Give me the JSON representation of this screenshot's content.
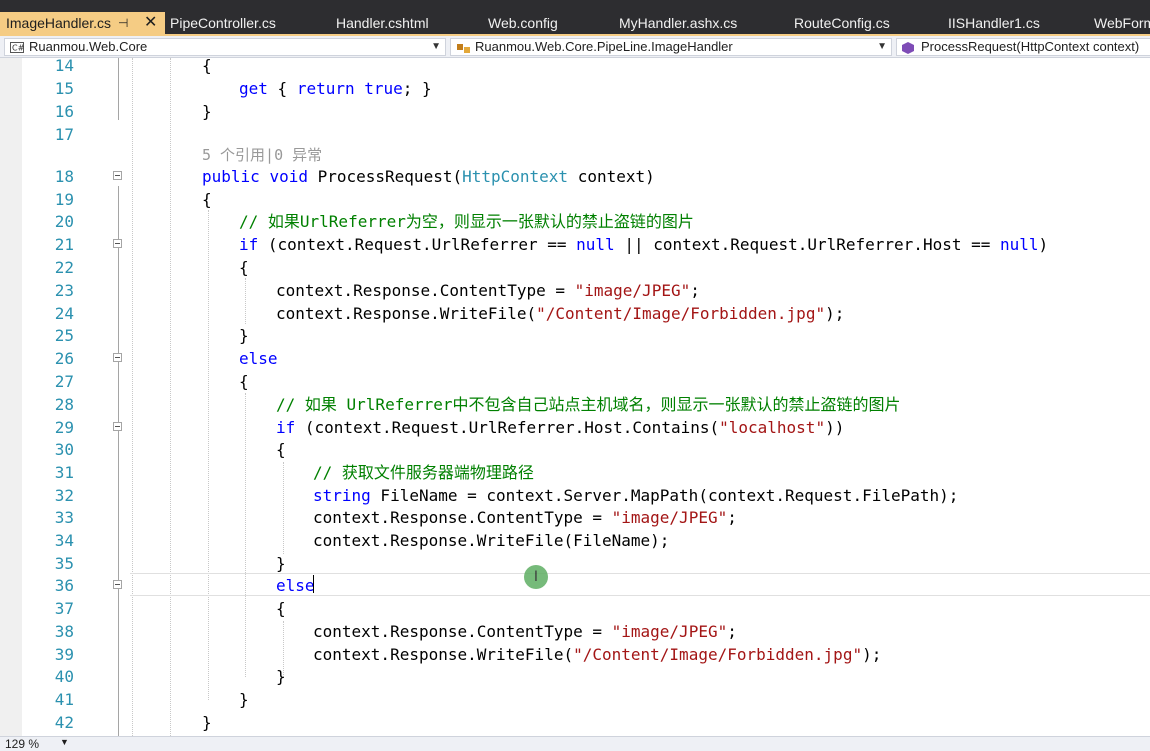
{
  "tabs": [
    {
      "label": "ImageHandler.cs",
      "active": true
    },
    {
      "label": "PipeController.cs"
    },
    {
      "label": "Handler.cshtml"
    },
    {
      "label": "Web.config"
    },
    {
      "label": "MyHandler.ashx.cs"
    },
    {
      "label": "RouteConfig.cs"
    },
    {
      "label": "IISHandler1.cs"
    },
    {
      "label": "WebForm"
    }
  ],
  "tab_pin": "⊣",
  "tab_close": "✕",
  "nav": {
    "project": "Ruanmou.Web.Core",
    "type": "Ruanmou.Web.Core.PipeLine.ImageHandler",
    "member": "ProcessRequest(HttpContext context)"
  },
  "code": {
    "ref_hint": "5 个引用|0 异常",
    "lines": {
      "l14": "{",
      "l15_kw1": "get",
      "l15_p1": " { ",
      "l15_kw2": "return",
      "l15_kw3": "true",
      "l15_p2": "; }",
      "l16": "}",
      "l18_kw1": "public",
      "l18_kw2": "void",
      "l18_p1": " ProcessRequest(",
      "l18_ty": "HttpContext",
      "l18_p2": " context)",
      "l19": "{",
      "l20": "// 如果UrlReferrer为空，则显示一张默认的禁止盗链的图片",
      "l21_kw": "if",
      "l21_p1": " (context.Request.UrlReferrer == ",
      "l21_null1": "null",
      "l21_p2": " || context.Request.UrlReferrer.Host == ",
      "l21_null2": "null",
      "l21_p3": ")",
      "l22": "{",
      "l23_p": "context.Response.ContentType = ",
      "l23_s": "\"image/JPEG\"",
      "l23_e": ";",
      "l24_p": "context.Response.WriteFile(",
      "l24_s": "\"/Content/Image/Forbidden.jpg\"",
      "l24_e": ");",
      "l25": "}",
      "l26": "else",
      "l27": "{",
      "l28": "// 如果 UrlReferrer中不包含自己站点主机域名，则显示一张默认的禁止盗链的图片",
      "l29_kw": "if",
      "l29_p": " (context.Request.UrlReferrer.Host.Contains(",
      "l29_s": "\"localhost\"",
      "l29_e": "))",
      "l30": "{",
      "l31": "// 获取文件服务器端物理路径",
      "l32_kw": "string",
      "l32_p": " FileName = context.Server.MapPath(context.Request.FilePath);",
      "l33_p": "context.Response.ContentType = ",
      "l33_s": "\"image/JPEG\"",
      "l33_e": ";",
      "l34": "context.Response.WriteFile(FileName);",
      "l35": "}",
      "l36": "else",
      "l37": "{",
      "l38_p": "context.Response.ContentType = ",
      "l38_s": "\"image/JPEG\"",
      "l38_e": ";",
      "l39_p": "context.Response.WriteFile(",
      "l39_s": "\"/Content/Image/Forbidden.jpg\"",
      "l39_e": ");",
      "l40": "}",
      "l41": "}",
      "l42": "}"
    }
  },
  "status": {
    "zoom": "129 %",
    "zoom_arrow": "▼"
  },
  "mouse_glyph": "I",
  "nav_arrow": "▼",
  "colors": {
    "active_tab": "#f5cc84",
    "tab_bar": "#2d2d30",
    "keyword": "#0000ff",
    "type": "#2b91af",
    "comment": "#008000",
    "string": "#a31515"
  }
}
